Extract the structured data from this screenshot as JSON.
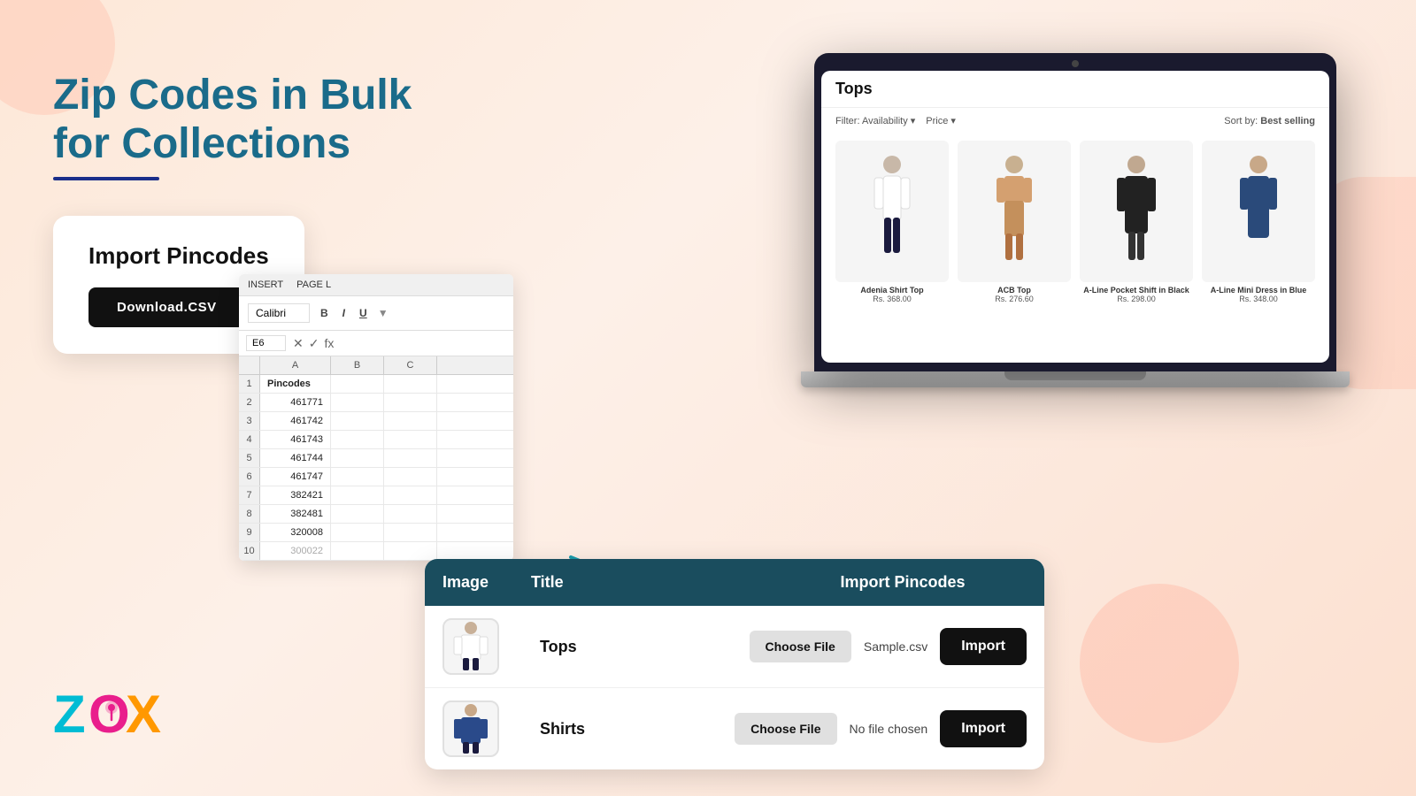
{
  "page": {
    "background": "#fde8d8"
  },
  "header": {
    "title_line1": "Zip Codes in Bulk",
    "title_line2": "for Collections"
  },
  "import_card": {
    "title": "Import Pincodes",
    "download_btn_label": "Download.CSV"
  },
  "excel": {
    "tabs": [
      "INSERT",
      "PAGE L"
    ],
    "active_tab": "INSERT",
    "font": "Calibri",
    "toolbar_buttons": [
      "B",
      "I",
      "U"
    ],
    "cell_ref": "E6",
    "column_headers": [
      "A",
      "B",
      "C"
    ],
    "rows": [
      {
        "row": 1,
        "col_a": "Pincodes",
        "col_b": "",
        "col_c": ""
      },
      {
        "row": 2,
        "col_a": "461771",
        "col_b": "",
        "col_c": ""
      },
      {
        "row": 3,
        "col_a": "461742",
        "col_b": "",
        "col_c": ""
      },
      {
        "row": 4,
        "col_a": "461743",
        "col_b": "",
        "col_c": ""
      },
      {
        "row": 5,
        "col_a": "461744",
        "col_b": "",
        "col_c": ""
      },
      {
        "row": 6,
        "col_a": "461747",
        "col_b": "",
        "col_c": ""
      },
      {
        "row": 7,
        "col_a": "382421",
        "col_b": "",
        "col_c": ""
      },
      {
        "row": 8,
        "col_a": "382481",
        "col_b": "",
        "col_c": ""
      },
      {
        "row": 9,
        "col_a": "320008",
        "col_b": "",
        "col_c": ""
      },
      {
        "row": 10,
        "col_a": "300022",
        "col_b": "",
        "col_c": ""
      }
    ]
  },
  "laptop": {
    "store_title": "Tops",
    "filters": [
      "Availability",
      "Price"
    ],
    "sort_label": "Sort by:",
    "sort_value": "Best selling",
    "products": [
      {
        "name": "Adenia Shirt Top",
        "price": "Rs. 368.00"
      },
      {
        "name": "ACB Top",
        "price": "Rs. 276.60"
      },
      {
        "name": "A-Line Pocket Shift in Black",
        "price": "Rs. 298.00"
      },
      {
        "name": "A-Line Mini Dress in Blue",
        "price": "Rs. 348.00"
      }
    ]
  },
  "table": {
    "col_headers": [
      "Image",
      "Title",
      "Import Pincodes"
    ],
    "rows": [
      {
        "title": "Tops",
        "choose_file_label": "Choose File",
        "file_status": "Sample.csv",
        "import_label": "Import"
      },
      {
        "title": "Shirts",
        "choose_file_label": "Choose File",
        "file_status": "No file chosen",
        "import_label": "Import"
      }
    ]
  },
  "logo": {
    "letters": [
      "Z",
      "O",
      "X"
    ]
  },
  "colors": {
    "teal_dark": "#1a4d5e",
    "teal_title": "#1a6b8a",
    "black": "#111111",
    "light_gray": "#e0e0e0"
  }
}
